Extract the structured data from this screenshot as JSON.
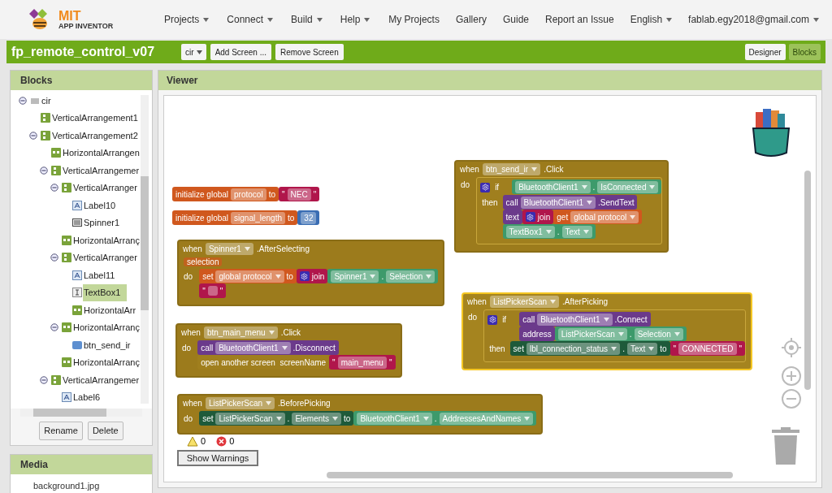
{
  "logo": {
    "title": "MIT",
    "subtitle": "APP INVENTOR"
  },
  "menu": [
    {
      "label": "Projects",
      "caret": true
    },
    {
      "label": "Connect",
      "caret": true
    },
    {
      "label": "Build",
      "caret": true
    },
    {
      "label": "Help",
      "caret": true
    }
  ],
  "links": [
    {
      "label": "My Projects",
      "caret": false
    },
    {
      "label": "Gallery",
      "caret": false
    },
    {
      "label": "Guide",
      "caret": false
    },
    {
      "label": "Report an Issue",
      "caret": false
    },
    {
      "label": "English",
      "caret": true
    },
    {
      "label": "fablab.egy2018@gmail.com",
      "caret": true
    }
  ],
  "project": {
    "title": "fp_remote_control_v07",
    "screen": "cir",
    "buttons": [
      "Add Screen ...",
      "Remove Screen"
    ],
    "tabs": [
      {
        "label": "Designer",
        "selected": false
      },
      {
        "label": "Blocks",
        "selected": true
      }
    ]
  },
  "blocks_panel": {
    "title": "Blocks",
    "tree": [
      {
        "label": "cir",
        "kind": "screen",
        "expanded": true,
        "selected": false,
        "children": [
          {
            "label": "VerticalArrangement1",
            "kind": "vertical",
            "selected": false
          },
          {
            "label": "VerticalArrangement2",
            "kind": "vertical",
            "expanded": true,
            "selected": false,
            "children": [
              {
                "label": "HorizontalArrangen",
                "kind": "horizontal",
                "selected": false
              },
              {
                "label": "VerticalArrangemer",
                "kind": "vertical",
                "expanded": true,
                "selected": false,
                "children": [
                  {
                    "label": "VerticalArranger",
                    "kind": "vertical",
                    "expanded": true,
                    "selected": false,
                    "children": [
                      {
                        "label": "Label10",
                        "kind": "label",
                        "selected": false
                      },
                      {
                        "label": "Spinner1",
                        "kind": "spinner",
                        "selected": false
                      }
                    ]
                  },
                  {
                    "label": "HorizontalArranç",
                    "kind": "horizontal",
                    "selected": false
                  },
                  {
                    "label": "VerticalArranger",
                    "kind": "vertical",
                    "expanded": true,
                    "selected": false,
                    "children": [
                      {
                        "label": "Label11",
                        "kind": "label",
                        "selected": false
                      },
                      {
                        "label": "TextBox1",
                        "kind": "textbox",
                        "selected": true
                      },
                      {
                        "label": "HorizontalArr",
                        "kind": "horizontal",
                        "selected": false
                      }
                    ]
                  },
                  {
                    "label": "HorizontalArranç",
                    "kind": "horizontal",
                    "expanded": true,
                    "selected": false,
                    "children": [
                      {
                        "label": "btn_send_ir",
                        "kind": "button",
                        "selected": false
                      }
                    ]
                  },
                  {
                    "label": "HorizontalArranç",
                    "kind": "horizontal",
                    "selected": false
                  }
                ]
              },
              {
                "label": "VerticalArrangemer",
                "kind": "vertical",
                "expanded": true,
                "selected": false,
                "children": [
                  {
                    "label": "Label6",
                    "kind": "label",
                    "selected": false
                  }
                ]
              }
            ]
          }
        ]
      }
    ],
    "buttons": [
      "Rename",
      "Delete"
    ]
  },
  "media_panel": {
    "title": "Media",
    "items": [
      "background1.jpg"
    ]
  },
  "viewer": {
    "title": "Viewer",
    "warnings": "0",
    "errors": "0",
    "warnings_button": "Show Warnings",
    "blocks": [
      {
        "kind": "global",
        "segments": [
          {
            "kind": "global",
            "tokens": [
              {
                "kind": "label",
                "text": "initialize global"
              },
              {
                "kind": "field",
                "text": "protocol"
              },
              {
                "kind": "label",
                "text": "to"
              }
            ]
          },
          {
            "kind": "string",
            "tokens": [
              {
                "kind": "label",
                "text": "\""
              },
              {
                "kind": "field",
                "text": "NEC"
              },
              {
                "kind": "label",
                "text": "\""
              }
            ]
          }
        ]
      },
      {
        "kind": "global",
        "segments": [
          {
            "kind": "global",
            "tokens": [
              {
                "kind": "label",
                "text": "initialize global"
              },
              {
                "kind": "field",
                "text": "signal_length"
              },
              {
                "kind": "label",
                "text": "to"
              }
            ]
          },
          {
            "kind": "number",
            "tokens": [
              {
                "kind": "field",
                "text": "32"
              }
            ]
          }
        ]
      },
      {
        "kind": "event",
        "selected": false,
        "header": [
          {
            "kind": "label",
            "text": "when"
          },
          {
            "kind": "dropdown",
            "text": "Spinner1"
          },
          {
            "kind": "label",
            "text": ".AfterSelecting"
          }
        ],
        "param": "selection",
        "do": "do",
        "body": [
          {
            "kind": "row",
            "lines": [
              [
                {
                  "kind": "global",
                  "tokens": [
                    {
                      "kind": "label",
                      "text": "set"
                    },
                    {
                      "kind": "dropdown",
                      "text": "global protocol"
                    },
                    {
                      "kind": "label",
                      "text": "to"
                    }
                  ]
                },
                {
                  "kind": "string",
                  "tokens": [
                    {
                      "kind": "gear"
                    },
                    {
                      "kind": "label",
                      "text": "join"
                    }
                  ]
                },
                {
                  "kind": "getter",
                  "tokens": [
                    {
                      "kind": "dropdown",
                      "text": "Spinner1"
                    },
                    {
                      "kind": "label",
                      "text": "."
                    },
                    {
                      "kind": "dropdown",
                      "text": "Selection"
                    }
                  ]
                }
              ],
              [
                {
                  "kind": "string",
                  "tokens": [
                    {
                      "kind": "label",
                      "text": "\""
                    },
                    {
                      "kind": "blank"
                    },
                    {
                      "kind": "label",
                      "text": "\""
                    }
                  ]
                }
              ]
            ]
          }
        ]
      },
      {
        "kind": "event",
        "selected": false,
        "header": [
          {
            "kind": "label",
            "text": "when"
          },
          {
            "kind": "dropdown",
            "text": "btn_main_menu"
          },
          {
            "kind": "label",
            "text": ".Click"
          }
        ],
        "do": "do",
        "body": [
          {
            "kind": "row",
            "lines": [
              [
                {
                  "kind": "method",
                  "tokens": [
                    {
                      "kind": "label",
                      "text": "call"
                    },
                    {
                      "kind": "dropdown",
                      "text": "BluetoothClient1"
                    },
                    {
                      "kind": "label",
                      "text": ".Disconnect"
                    }
                  ]
                }
              ]
            ]
          },
          {
            "kind": "row",
            "lines": [
              [
                {
                  "kind": "control",
                  "tokens": [
                    {
                      "kind": "label",
                      "text": "open another screen  screenName"
                    }
                  ]
                },
                {
                  "kind": "string",
                  "tokens": [
                    {
                      "kind": "label",
                      "text": "\""
                    },
                    {
                      "kind": "field",
                      "text": "main_menu"
                    },
                    {
                      "kind": "label",
                      "text": "\""
                    }
                  ]
                }
              ]
            ]
          }
        ]
      },
      {
        "kind": "event",
        "selected": false,
        "header": [
          {
            "kind": "label",
            "text": "when"
          },
          {
            "kind": "dropdown",
            "text": "ListPickerScan"
          },
          {
            "kind": "label",
            "text": ".BeforePicking"
          }
        ],
        "do": "do",
        "body": [
          {
            "kind": "row",
            "lines": [
              [
                {
                  "kind": "setter",
                  "tokens": [
                    {
                      "kind": "label",
                      "text": "set"
                    },
                    {
                      "kind": "dropdown",
                      "text": "ListPickerScan"
                    },
                    {
                      "kind": "label",
                      "text": "."
                    },
                    {
                      "kind": "dropdown",
                      "text": "Elements"
                    },
                    {
                      "kind": "label",
                      "text": "to"
                    }
                  ]
                },
                {
                  "kind": "getter",
                  "tokens": [
                    {
                      "kind": "dropdown",
                      "text": "BluetoothClient1"
                    },
                    {
                      "kind": "label",
                      "text": "."
                    },
                    {
                      "kind": "dropdown",
                      "text": "AddressesAndNames"
                    }
                  ]
                }
              ]
            ]
          }
        ]
      },
      {
        "kind": "event",
        "selected": false,
        "header": [
          {
            "kind": "label",
            "text": "when"
          },
          {
            "kind": "dropdown",
            "text": "btn_send_ir"
          },
          {
            "kind": "label",
            "text": ".Click"
          }
        ],
        "do": "do",
        "body": [
          {
            "kind": "if",
            "if": "if",
            "then": "then",
            "cond": [
              [
                {
                  "kind": "getter",
                  "tokens": [
                    {
                      "kind": "dropdown",
                      "text": "BluetoothClient1"
                    },
                    {
                      "kind": "label",
                      "text": "."
                    },
                    {
                      "kind": "dropdown",
                      "text": "IsConnected"
                    }
                  ]
                }
              ]
            ],
            "body": [
              {
                "kind": "row",
                "lines": [
                  [
                    {
                      "kind": "method",
                      "tokens": [
                        {
                          "kind": "label",
                          "text": "call"
                        },
                        {
                          "kind": "dropdown",
                          "text": "BluetoothClient1"
                        },
                        {
                          "kind": "label",
                          "text": ".SendText"
                        }
                      ]
                    }
                  ],
                  [
                    {
                      "kind": "method",
                      "tokens": [
                        {
                          "kind": "label",
                          "text": "text"
                        }
                      ]
                    },
                    {
                      "kind": "string",
                      "tokens": [
                        {
                          "kind": "gear"
                        },
                        {
                          "kind": "label",
                          "text": "join"
                        }
                      ]
                    },
                    {
                      "kind": "global",
                      "tokens": [
                        {
                          "kind": "label",
                          "text": "get"
                        },
                        {
                          "kind": "dropdown",
                          "text": "global protocol"
                        }
                      ]
                    }
                  ],
                  [
                    {
                      "kind": "getter",
                      "tokens": [
                        {
                          "kind": "dropdown",
                          "text": "TextBox1"
                        },
                        {
                          "kind": "label",
                          "text": "."
                        },
                        {
                          "kind": "dropdown",
                          "text": "Text"
                        }
                      ]
                    }
                  ]
                ]
              }
            ]
          }
        ]
      },
      {
        "kind": "event",
        "selected": true,
        "header": [
          {
            "kind": "label",
            "text": "when"
          },
          {
            "kind": "dropdown",
            "text": "ListPickerScan"
          },
          {
            "kind": "label",
            "text": ".AfterPicking"
          }
        ],
        "do": "do",
        "body": [
          {
            "kind": "if",
            "if": "if",
            "then": "then",
            "cond": [
              [
                {
                  "kind": "method",
                  "tokens": [
                    {
                      "kind": "label",
                      "text": "call"
                    },
                    {
                      "kind": "dropdown",
                      "text": "BluetoothClient1"
                    },
                    {
                      "kind": "label",
                      "text": ".Connect"
                    }
                  ]
                }
              ],
              [
                {
                  "kind": "method",
                  "tokens": [
                    {
                      "kind": "label",
                      "text": "address"
                    }
                  ]
                },
                {
                  "kind": "getter",
                  "tokens": [
                    {
                      "kind": "dropdown",
                      "text": "ListPickerScan"
                    },
                    {
                      "kind": "label",
                      "text": "."
                    },
                    {
                      "kind": "dropdown",
                      "text": "Selection"
                    }
                  ]
                }
              ]
            ],
            "body": [
              {
                "kind": "row",
                "lines": [
                  [
                    {
                      "kind": "setter",
                      "tokens": [
                        {
                          "kind": "label",
                          "text": "set"
                        },
                        {
                          "kind": "dropdown",
                          "text": "lbl_connection_status"
                        },
                        {
                          "kind": "label",
                          "text": "."
                        },
                        {
                          "kind": "dropdown",
                          "text": "Text"
                        },
                        {
                          "kind": "label",
                          "text": "to"
                        }
                      ]
                    },
                    {
                      "kind": "string",
                      "tokens": [
                        {
                          "kind": "label",
                          "text": "\""
                        },
                        {
                          "kind": "field",
                          "text": "CONNECTED"
                        },
                        {
                          "kind": "label",
                          "text": "\""
                        }
                      ]
                    }
                  ]
                ]
              }
            ]
          }
        ]
      }
    ]
  }
}
